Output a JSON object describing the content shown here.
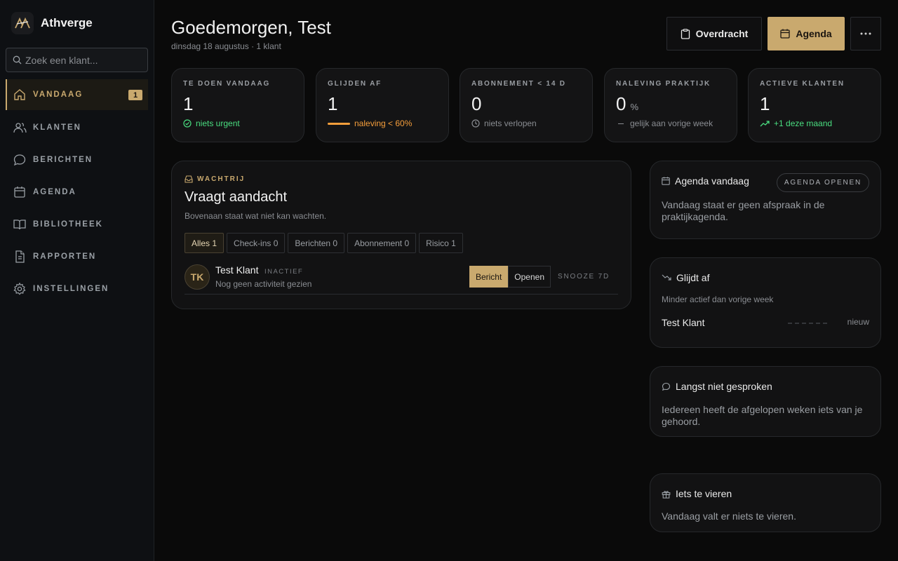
{
  "brand": {
    "name": "Athverge"
  },
  "search": {
    "placeholder": "Zoek een klant..."
  },
  "nav": [
    {
      "label": "VANDAAG",
      "icon": "home-icon",
      "active": true,
      "badge": "1"
    },
    {
      "label": "KLANTEN",
      "icon": "users-icon"
    },
    {
      "label": "BERICHTEN",
      "icon": "chat-icon"
    },
    {
      "label": "AGENDA",
      "icon": "calendar-icon"
    },
    {
      "label": "BIBLIOTHEEK",
      "icon": "book-icon"
    },
    {
      "label": "RAPPORTEN",
      "icon": "document-icon"
    },
    {
      "label": "INSTELLINGEN",
      "icon": "gear-icon"
    }
  ],
  "header": {
    "greeting": "Goedemorgen, Test",
    "subtitle": "dinsdag 18 augustus · 1 klant",
    "overdracht_label": "Overdracht",
    "agenda_label": "Agenda"
  },
  "stats": [
    {
      "label": "TE DOEN VANDAAG",
      "value": "1",
      "foot": "niets urgent"
    },
    {
      "label": "GLIJDEN AF",
      "value": "1",
      "foot": "naleving < 60%"
    },
    {
      "label": "ABONNEMENT < 14 D",
      "value": "0",
      "foot": "niets verlopen"
    },
    {
      "label": "NALEVING PRAKTIJK",
      "value": "0",
      "unit": "%",
      "foot": "gelijk aan vorige week"
    },
    {
      "label": "ACTIEVE KLANTEN",
      "value": "1",
      "foot": "+1 deze maand"
    }
  ],
  "queue": {
    "kicker": "WACHTRIJ",
    "title": "Vraagt aandacht",
    "subtitle": "Bovenaan staat wat niet kan wachten.",
    "filters": [
      "Alles 1",
      "Check-ins 0",
      "Berichten 0",
      "Abonnement 0",
      "Risico 1"
    ],
    "client": {
      "initials": "TK",
      "name": "Test Klant",
      "status": "INACTIEF",
      "note": "Nog geen activiteit gezien",
      "message_label": "Bericht",
      "open_label": "Openen",
      "snooze_label": "SNOOZE 7D"
    }
  },
  "agenda_card": {
    "title": "Agenda vandaag",
    "button": "AGENDA OPENEN",
    "body": "Vandaag staat er geen afspraak in de praktijkagenda."
  },
  "slipping_card": {
    "title": "Glijdt af",
    "subtitle": "Minder actief dan vorige week",
    "client": "Test Klant",
    "tag": "nieuw"
  },
  "silent_card": {
    "title": "Langst niet gesproken",
    "body": "Iedereen heeft de afgelopen weken iets van je gehoord."
  },
  "celebrate_card": {
    "title": "Iets te vieren",
    "body": "Vandaag valt er niets te vieren."
  },
  "colors": {
    "accent": "#c9a96e",
    "green": "#4ade80",
    "orange": "#f59e3b"
  }
}
